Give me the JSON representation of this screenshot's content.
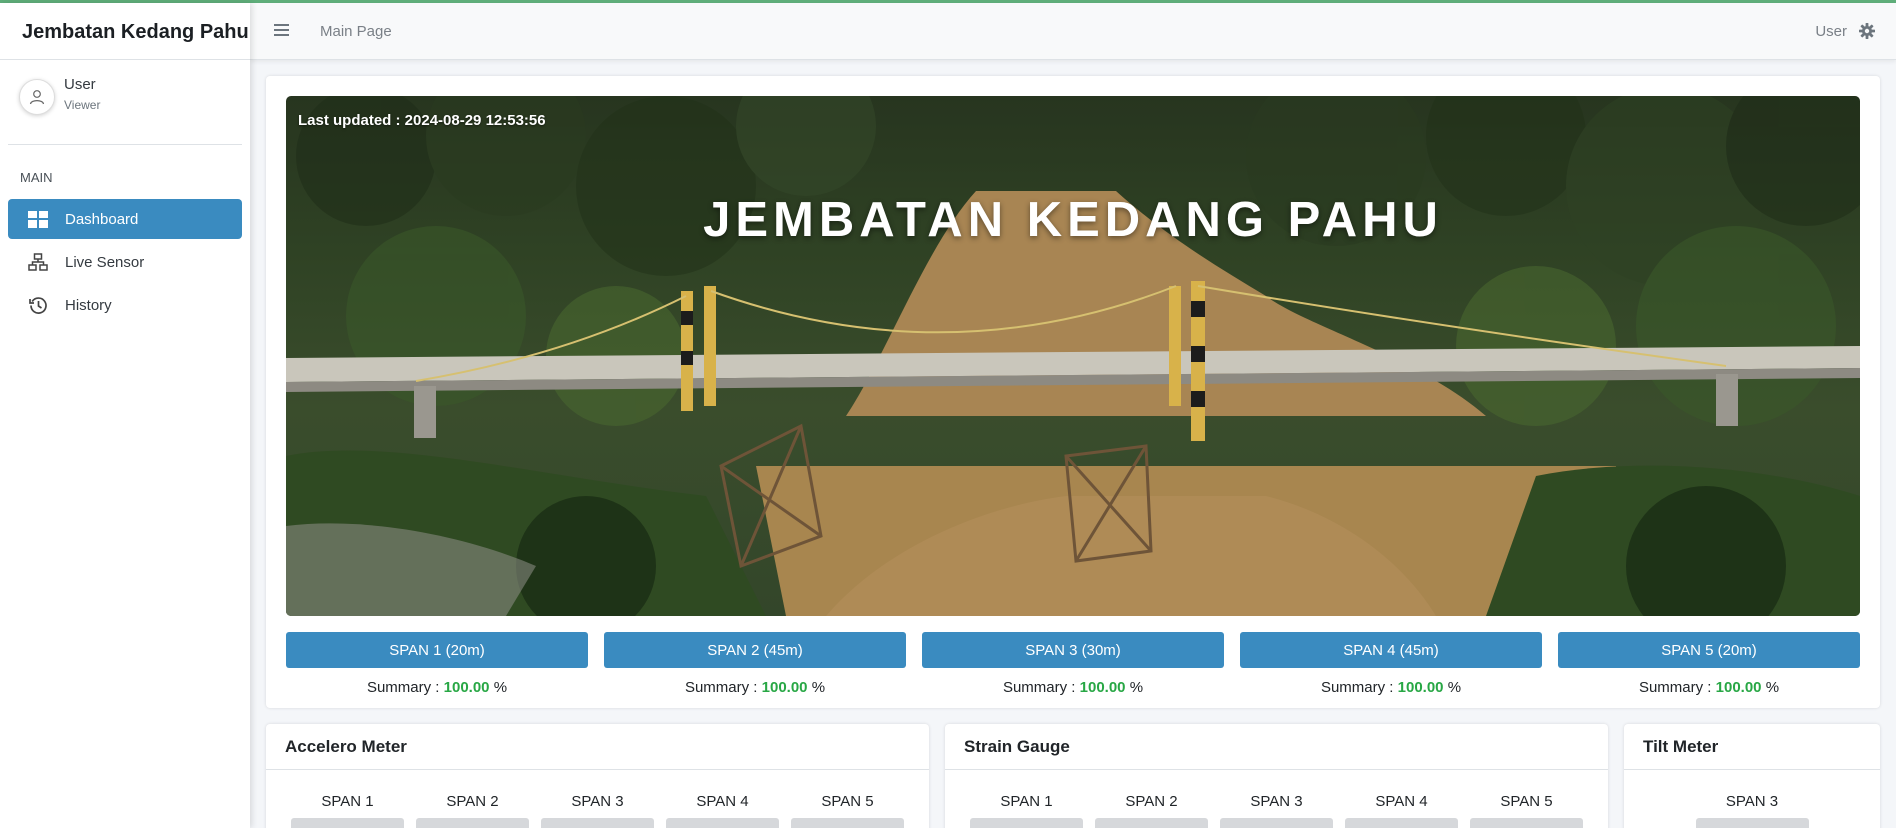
{
  "app": {
    "brand": "Jembatan Kedang Pahu",
    "breadcrumb": "Main Page"
  },
  "user": {
    "name": "User",
    "role": "Viewer"
  },
  "sidebar": {
    "section": "MAIN",
    "items": [
      {
        "label": "Dashboard",
        "icon": "dashboard-grid-icon",
        "active": true
      },
      {
        "label": "Live Sensor",
        "icon": "network-icon",
        "active": false
      },
      {
        "label": "History",
        "icon": "history-icon",
        "active": false
      }
    ]
  },
  "topbar": {
    "user_label": "User"
  },
  "hero": {
    "last_updated": "Last updated : 2024-08-29 12:53:56",
    "title": "JEMBATAN KEDANG PAHU"
  },
  "spans": [
    {
      "label": "SPAN 1 (20m)",
      "summary_prefix": "Summary : ",
      "value": "100.00",
      "unit": " %"
    },
    {
      "label": "SPAN 2 (45m)",
      "summary_prefix": "Summary : ",
      "value": "100.00",
      "unit": " %"
    },
    {
      "label": "SPAN 3 (30m)",
      "summary_prefix": "Summary : ",
      "value": "100.00",
      "unit": " %"
    },
    {
      "label": "SPAN 4 (45m)",
      "summary_prefix": "Summary : ",
      "value": "100.00",
      "unit": " %"
    },
    {
      "label": "SPAN 5 (20m)",
      "summary_prefix": "Summary : ",
      "value": "100.00",
      "unit": " %"
    }
  ],
  "cards": {
    "accelero": {
      "title": "Accelero Meter",
      "spans": [
        "SPAN 1",
        "SPAN 2",
        "SPAN 3",
        "SPAN 4",
        "SPAN 5"
      ]
    },
    "strain": {
      "title": "Strain Gauge",
      "spans": [
        "SPAN 1",
        "SPAN 2",
        "SPAN 3",
        "SPAN 4",
        "SPAN 5"
      ]
    },
    "tilt": {
      "title": "Tilt Meter",
      "spans": [
        "SPAN 3"
      ]
    }
  },
  "colors": {
    "primary": "#3a8bc0",
    "success": "#28a745"
  }
}
